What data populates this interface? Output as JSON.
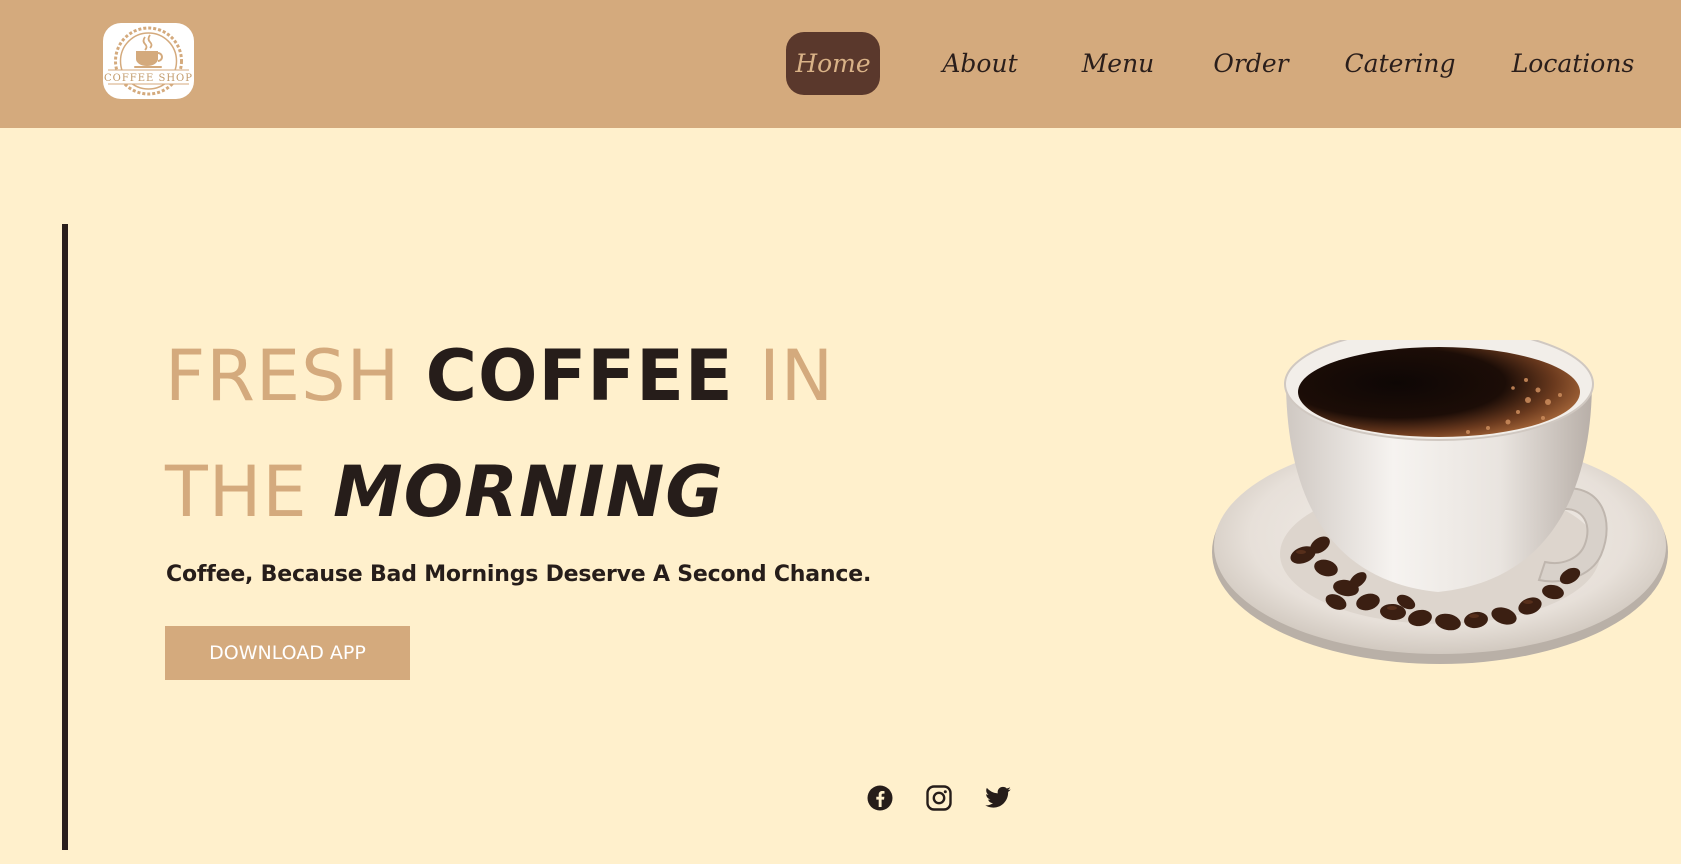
{
  "logo": {
    "text": "COFFEE SHOP",
    "icon": "coffee-cup-icon"
  },
  "nav": {
    "items": [
      {
        "label": "Home",
        "active": true
      },
      {
        "label": "About",
        "active": false
      },
      {
        "label": "Menu",
        "active": false
      },
      {
        "label": "Order",
        "active": false
      },
      {
        "label": "Catering",
        "active": false
      },
      {
        "label": "Locations",
        "active": false
      }
    ]
  },
  "hero": {
    "line1": {
      "word1": "FRESH",
      "word2": "COFFEE",
      "word3": "IN"
    },
    "line2": {
      "word1": "THE",
      "word2": "MORNING"
    },
    "tagline": "Coffee, Because Bad Mornings Deserve A Second Chance.",
    "cta_label": "DOWNLOAD APP",
    "image": "coffee-cup-with-saucer-and-beans"
  },
  "social": {
    "icons": [
      "facebook-icon",
      "instagram-icon",
      "twitter-icon"
    ]
  },
  "colors": {
    "header_bg": "#d4aa7d",
    "page_bg": "#fff0cc",
    "accent": "#d4aa7d",
    "dark": "#261d1a",
    "active_nav_bg": "#5a382c"
  }
}
